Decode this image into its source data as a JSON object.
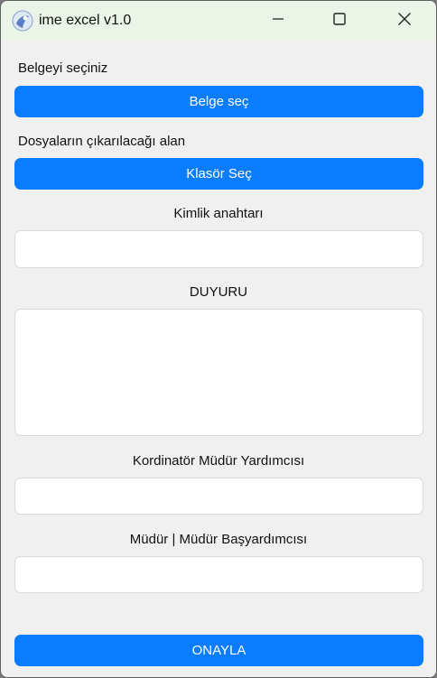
{
  "window": {
    "title": "ime excel v1.0",
    "icons": {
      "app": "app-logo-icon",
      "minimize": "minimize-icon",
      "maximize": "maximize-icon",
      "close": "close-icon"
    }
  },
  "form": {
    "document_label": "Belgeyi seçiniz",
    "document_button": "Belge seç",
    "folder_label": "Dosyaların çıkarılacağı alan",
    "folder_button": "Klasör Seç",
    "identity_key_label": "Kimlik anahtarı",
    "identity_key_value": "",
    "announcement_label": "DUYURU",
    "announcement_value": "",
    "coordinator_label": "Kordinatör Müdür Yardımcısı",
    "coordinator_value": "",
    "principal_label": "Müdür | Müdür Başyardımcısı",
    "principal_value": "",
    "submit_button": "ONAYLA"
  },
  "colors": {
    "accent": "#0a7dff",
    "titlebar": "#eaf5e8",
    "background": "#f0f0f0"
  }
}
